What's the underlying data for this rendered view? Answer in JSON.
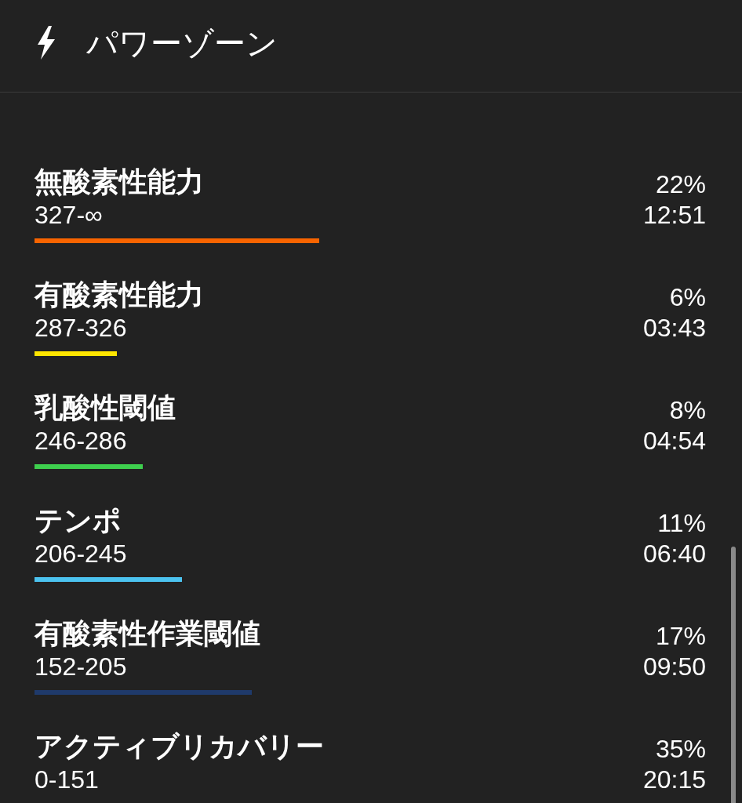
{
  "header": {
    "title": "パワーゾーン"
  },
  "zones": [
    {
      "name": "無酸素性能力",
      "range": "327-∞",
      "percent": "22%",
      "time": "12:51",
      "level": 0.424,
      "color": "#f86400"
    },
    {
      "name": "有酸素性能力",
      "range": "287-326",
      "percent": "6%",
      "time": "03:43",
      "level": 0.123,
      "color": "#ffe500"
    },
    {
      "name": "乳酸性閾値",
      "range": "246-286",
      "percent": "8%",
      "time": "04:54",
      "level": 0.161,
      "color": "#3ecf4e"
    },
    {
      "name": "テンポ",
      "range": "206-245",
      "percent": "11%",
      "time": "06:40",
      "level": 0.22,
      "color": "#4cc3ef"
    },
    {
      "name": "有酸素性作業閾値",
      "range": "152-205",
      "percent": "17%",
      "time": "09:50",
      "level": 0.324,
      "color": "#1f3a6b"
    },
    {
      "name": "アクティブリカバリー",
      "range": "0-151",
      "percent": "35%",
      "time": "20:15"
    }
  ]
}
